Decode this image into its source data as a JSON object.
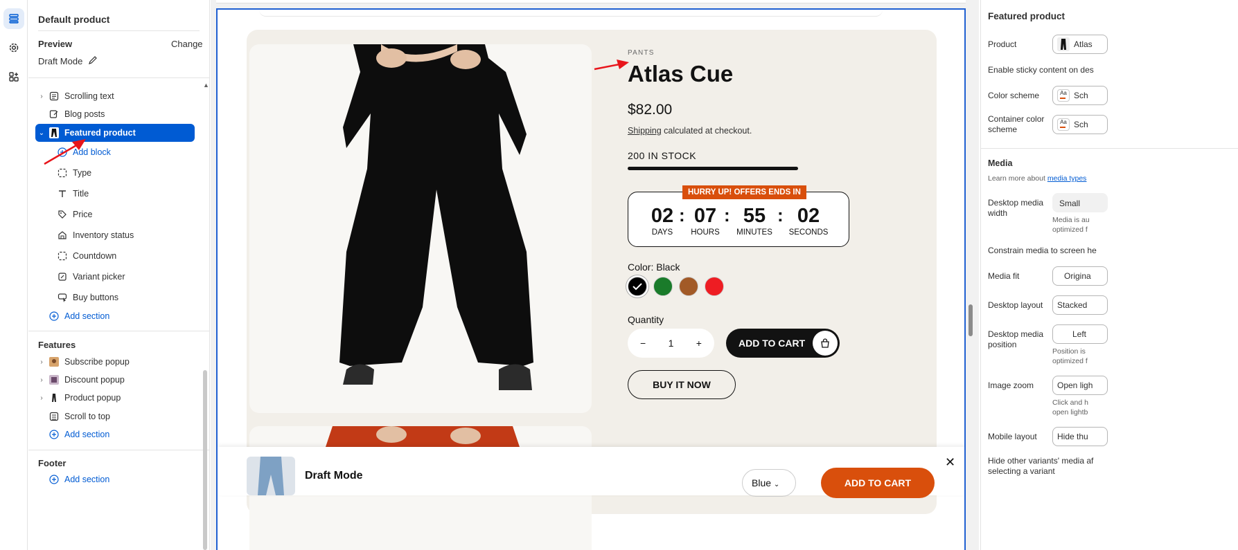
{
  "colors": {
    "accent": "#005bd3",
    "frame": "#1f5fd1",
    "countdown_badge": "#d94f0c",
    "annotation": "#e8151b"
  },
  "rail": {
    "icons": [
      "sections-icon",
      "settings-gear-icon",
      "apps-icon"
    ]
  },
  "left": {
    "title": "Default product",
    "preview_label": "Preview",
    "change_label": "Change",
    "draft_mode": "Draft Mode",
    "items": [
      {
        "label": "Scrolling text"
      },
      {
        "label": "Blog posts"
      },
      {
        "label": "Featured product"
      }
    ],
    "blocks": [
      {
        "label": "Add block"
      },
      {
        "label": "Type"
      },
      {
        "label": "Title"
      },
      {
        "label": "Price"
      },
      {
        "label": "Inventory status"
      },
      {
        "label": "Countdown"
      },
      {
        "label": "Variant picker"
      },
      {
        "label": "Buy buttons"
      }
    ],
    "add_section": "Add section",
    "features_title": "Features",
    "features": [
      {
        "label": "Subscribe popup"
      },
      {
        "label": "Discount popup"
      },
      {
        "label": "Product popup"
      },
      {
        "label": "Scroll to top"
      }
    ],
    "features_add_section": "Add section",
    "footer_title": "Footer",
    "footer_add_section": "Add section"
  },
  "product": {
    "type": "PANTS",
    "title": "Atlas Cue",
    "price": "$82.00",
    "shipping_link": "Shipping",
    "shipping_rest": " calculated at checkout.",
    "stock": "200 IN STOCK",
    "countdown": {
      "badge": "HURRY UP! OFFERS ENDS IN",
      "units": [
        {
          "num": "02",
          "label": "DAYS"
        },
        {
          "num": "07",
          "label": "HOURS"
        },
        {
          "num": "55",
          "label": "MINUTES"
        },
        {
          "num": "02",
          "label": "SECONDS"
        }
      ],
      "separator": ":"
    },
    "color_label": "Color: Black",
    "swatches": [
      "#000000",
      "#1a7b2a",
      "#a25a27",
      "#ee1d23"
    ],
    "quantity_label": "Quantity",
    "quantity": "1",
    "minus": "−",
    "plus": "+",
    "add_to_cart": "ADD TO CART",
    "buy_now": "BUY IT NOW"
  },
  "sticky": {
    "title": "Draft Mode",
    "variant": "Blue",
    "add_to_cart": "ADD TO CART",
    "close": "✕"
  },
  "right": {
    "title": "Featured product",
    "product_label": "Product",
    "product_value": "Atlas",
    "sticky_label": "Enable sticky content on des",
    "color_scheme_label": "Color scheme",
    "color_scheme_value": "Sch",
    "container_scheme_label": "Container color scheme",
    "container_scheme_value": "Sch",
    "media_title": "Media",
    "learn_prefix": "Learn more about ",
    "learn_link": "media types",
    "desktop_media_width_label": "Desktop media width",
    "desktop_media_width_value": "Small",
    "media_hint": "Media is au optimized f",
    "constrain_label": "Constrain media to screen he",
    "media_fit_label": "Media fit",
    "media_fit_value": "Origina",
    "desktop_layout_label": "Desktop layout",
    "desktop_layout_value": "Stacked",
    "desktop_position_label": "Desktop media position",
    "desktop_position_value": "Left",
    "position_hint": "Position is optimized f",
    "image_zoom_label": "Image zoom",
    "image_zoom_value": "Open ligh",
    "zoom_hint": "Click and h open lightb",
    "mobile_layout_label": "Mobile layout",
    "mobile_layout_value": "Hide thu",
    "hide_variants_label": "Hide other variants' media af selecting a variant"
  }
}
